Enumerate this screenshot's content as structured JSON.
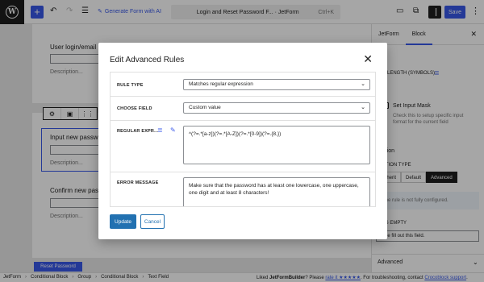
{
  "topbar": {
    "add_icon": "+",
    "generate_label": "Generate Form with AI",
    "doc_title": "Login and Reset Password F... · JetForm",
    "shortcut": "Ctrl+K",
    "save_label": "Save"
  },
  "canvas": {
    "field1_label": "User login/email",
    "field1_desc": "Description...",
    "field2_label": "Input new passwo",
    "field2_desc": "Description...",
    "field3_label": "Confirm new passw",
    "field3_desc": "Description...",
    "submit_label": "Reset Password"
  },
  "sidebar": {
    "tab_plugin": "JetForm",
    "tab_block": "Block",
    "length_label": "LENGTH (SYMBOLS)",
    "input_mask_label": "Set Input Mask",
    "input_mask_desc": "Check this to setup specific input format for the current field",
    "validation_heading": "dation",
    "validation_type_label": "DATION TYPE",
    "seg_inherit": "nherit",
    "seg_default": "Default",
    "seg_advanced": "Advanced",
    "notice": "The rule is not fully configured.",
    "is_empty_label": "D IS EMPTY",
    "is_empty_value": "ase fill out this field.",
    "advanced_section": "Advanced"
  },
  "modal": {
    "title": "Edit Advanced Rules",
    "rule_type_label": "RULE TYPE",
    "rule_type_value": "Matches regular expression",
    "choose_field_label": "CHOOSE FIELD",
    "choose_field_value": "Custom value",
    "regex_label": "REGULAR EXPR...",
    "regex_value": "^(?=.*[a-z])(?=.*[A-Z])(?=.*[0-9])(?=.{8,})",
    "error_label": "ERROR MESSAGE",
    "error_value": "Make sure that the password has at least one lowercase, one uppercase, one digit and at least 8 characters!",
    "update_label": "Update",
    "cancel_label": "Cancel"
  },
  "footer": {
    "crumbs": [
      "JetForm",
      "Conditional Block",
      "Group",
      "Conditional Block",
      "Text Field"
    ],
    "liked_prefix": "Liked ",
    "liked_brand": "JetFormBuilder",
    "liked_mid": "? Please ",
    "rate_link": "rate it ★★★★★",
    "trouble_text": ". For troubleshooting, contact ",
    "support_link": "Crocoblock support",
    "end_dot": "."
  },
  "colors": {
    "accent": "#3858e9",
    "wp_button": "#2271b1",
    "toolbar_dark": "#1e1e1e"
  }
}
